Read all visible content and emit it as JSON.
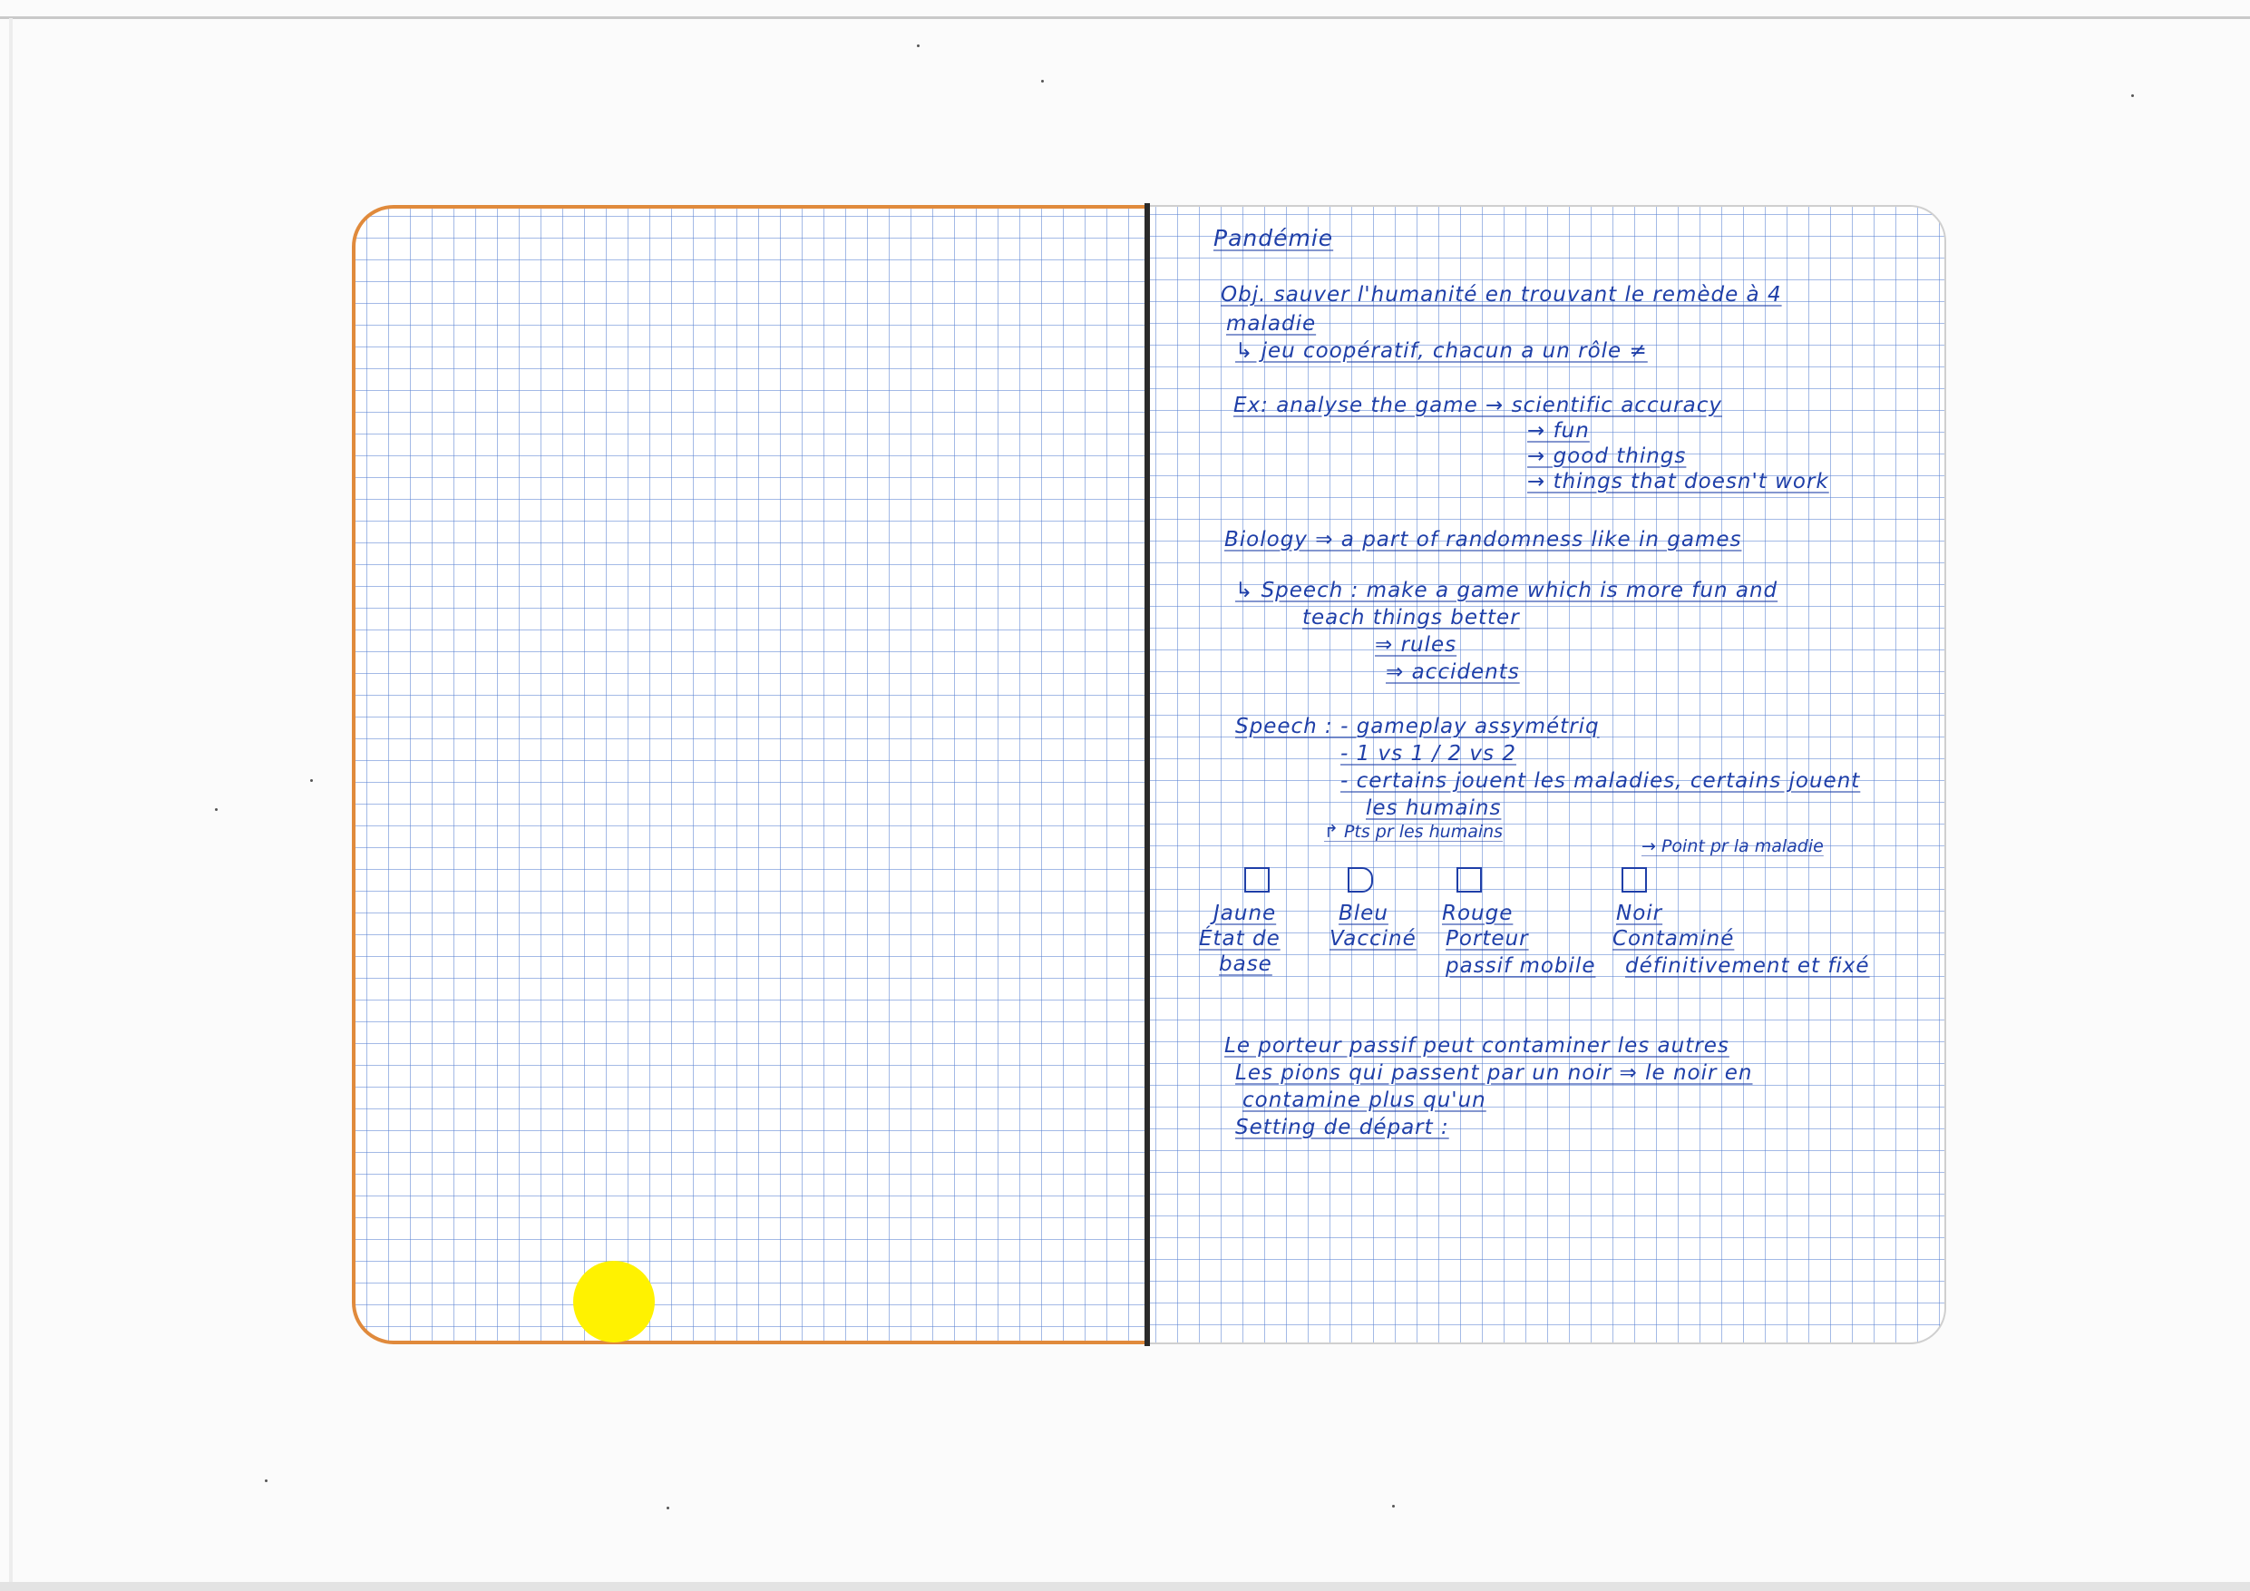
{
  "notes": {
    "title": "Pandémie",
    "objective_1": "Obj. sauver l'humanité en trouvant le remède à 4",
    "objective_2": "maladie",
    "objective_3": "↳ jeu coopératif, chacun a un rôle ≠",
    "ex_1": "Ex: analyse the game → scientific accuracy",
    "ex_2": "→ fun",
    "ex_3": "→ good things",
    "ex_4": "→ things that doesn't work",
    "biology": "Biology ⇒ a part of randomness like in games",
    "speech_1": "↳ Speech : make a game which is more fun and",
    "speech_2": "teach things better",
    "speech_3": "⇒ rules",
    "speech_4": "⇒ accidents",
    "speech2_1": "Speech : - gameplay assymétriq",
    "speech2_2": "- 1 vs 1 / 2 vs 2",
    "speech2_3": "- certains jouent les maladies, certains jouent",
    "speech2_4": "les humains",
    "arrow_humans": "↱ Pts pr les humains",
    "arrow_disease": "→ Point pr la maladie",
    "pieces": [
      {
        "label": "Jaune",
        "line2": "État de",
        "line3": "base"
      },
      {
        "label": "Bleu",
        "line2": "Vacciné",
        "line3": ""
      },
      {
        "label": "Rouge",
        "line2": "Porteur",
        "line3": "passif mobile"
      },
      {
        "label": "Noir",
        "line2": "Contaminé",
        "line3": "définitivement et fixé"
      }
    ],
    "carrier_1": "Le porteur passif peut contaminer les autres",
    "carrier_2": "Les pions qui passent par un noir ⇒ le noir en",
    "carrier_3": "contamine plus qu'un",
    "setting": "Setting de départ :"
  }
}
